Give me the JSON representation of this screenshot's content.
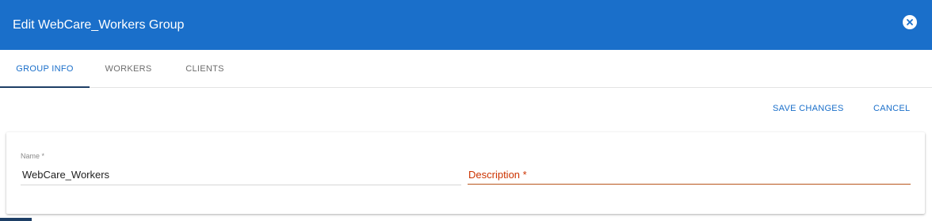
{
  "dialog": {
    "title": "Edit WebCare_Workers Group",
    "close_icon": "close-circle-icon"
  },
  "tabs": [
    {
      "label": "GROUP INFO",
      "active": true
    },
    {
      "label": "WORKERS",
      "active": false
    },
    {
      "label": "CLIENTS",
      "active": false
    }
  ],
  "actions": {
    "save_label": "SAVE CHANGES",
    "cancel_label": "CANCEL"
  },
  "form": {
    "name": {
      "label": "Name *",
      "value": "WebCare_Workers"
    },
    "description": {
      "label": "Description *",
      "value": ""
    }
  },
  "colors": {
    "header_bg": "#1a6fca",
    "accent": "#1a6fca",
    "tab_indicator": "#1e3f66",
    "error": "#cc3300"
  }
}
